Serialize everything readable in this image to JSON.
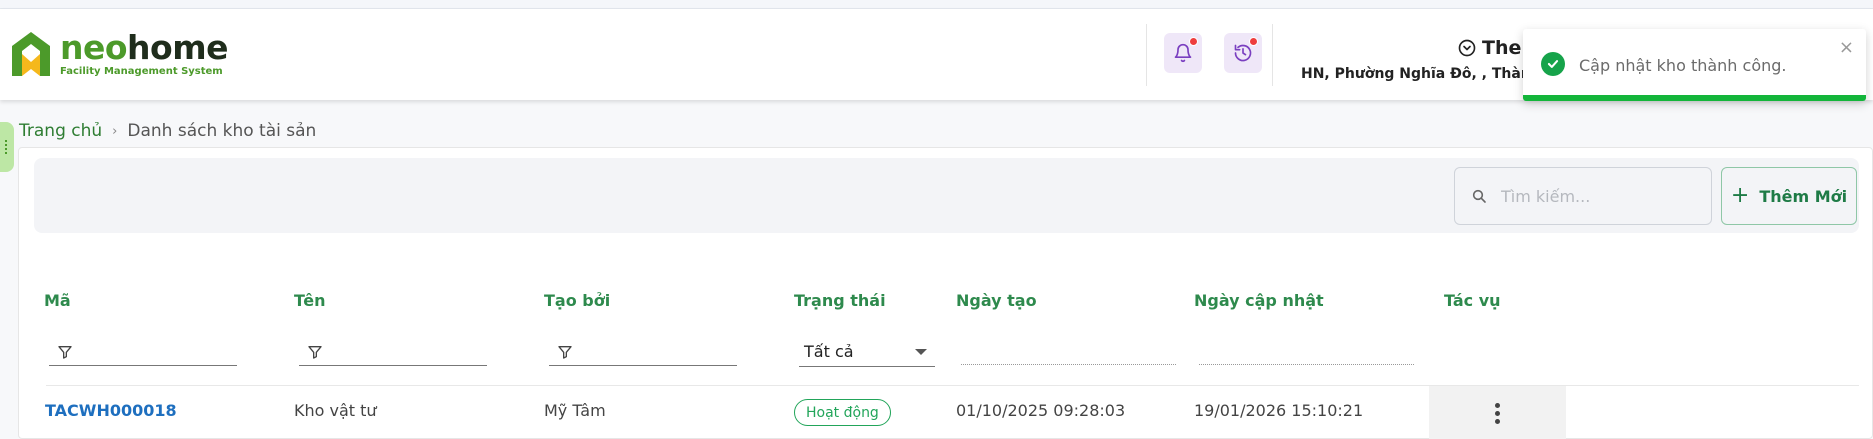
{
  "header": {
    "logo_neo": "neo",
    "logo_home": "home",
    "logo_sub": "Facility Management System",
    "location_title": "The",
    "location_addr": "HN, Phường Nghĩa Đô, , Thành phố"
  },
  "toast": {
    "message": "Cập nhật kho thành công.",
    "close": "×"
  },
  "breadcrumb": {
    "home": "Trang chủ",
    "separator": "›",
    "current": "Danh sách kho tài sản"
  },
  "toolbar": {
    "search_placeholder": "Tìm kiếm...",
    "add_label": "Thêm Mới",
    "add_icon": "+"
  },
  "table": {
    "columns": [
      "Mã",
      "Tên",
      "Tạo bởi",
      "Trạng thái",
      "Ngày tạo",
      "Ngày cập nhật",
      "Tác vụ"
    ],
    "status_filter": "Tất cả",
    "rows": [
      {
        "code": "TACWH000018",
        "name": "Kho vật tư",
        "created_by": "Mỹ Tâm",
        "status": "Hoạt động",
        "created_at": "01/10/2025 09:28:03",
        "updated_at": "19/01/2026 15:10:21"
      }
    ]
  },
  "colors": {
    "brand_green": "#4c9a2a",
    "header_green": "#2e8a4d",
    "link_blue": "#1e6fbf",
    "toast_bar": "#13b53a",
    "notification_dot": "#ee3d3d"
  }
}
